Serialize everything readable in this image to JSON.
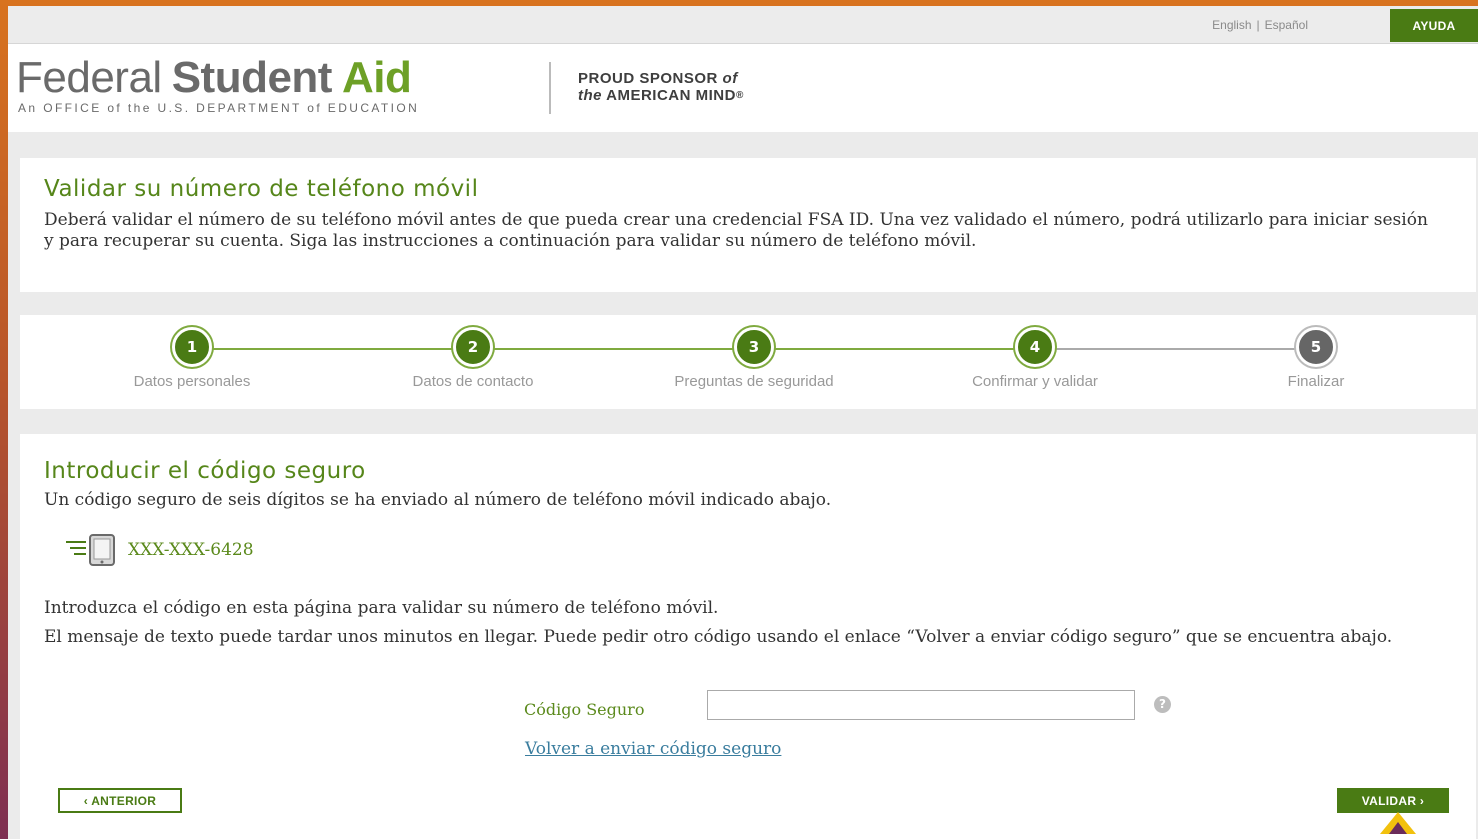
{
  "topbar": {
    "lang_english": "English",
    "lang_separator": "|",
    "lang_spanish": "Español",
    "help_label": "AYUDA"
  },
  "header": {
    "logo_word1": "Federal",
    "logo_word2": "Student",
    "logo_word3": "Aid",
    "logo_subtitle": "An OFFICE of the U.S. DEPARTMENT of EDUCATION",
    "sponsor_line1": "PROUD SPONSOR",
    "sponsor_of": "of",
    "sponsor_the": "the",
    "sponsor_line2": "AMERICAN MIND",
    "sponsor_mark": "®"
  },
  "intro": {
    "title": "Validar su número de teléfono móvil",
    "text": "Deberá validar el número de su teléfono móvil antes de que pueda crear una credencial FSA ID. Una vez validado el número, podrá utilizarlo para iniciar sesión y para recuperar su cuenta. Siga las instrucciones a continuación para validar su número de teléfono móvil."
  },
  "steps": [
    {
      "number": "1",
      "label": "Datos personales",
      "state": "complete"
    },
    {
      "number": "2",
      "label": "Datos de contacto",
      "state": "complete"
    },
    {
      "number": "3",
      "label": "Preguntas de seguridad",
      "state": "complete"
    },
    {
      "number": "4",
      "label": "Confirmar y validar",
      "state": "current"
    },
    {
      "number": "5",
      "label": "Finalizar",
      "state": "pending"
    }
  ],
  "form": {
    "title": "Introducir el código seguro",
    "description": "Un código seguro de seis dígitos se ha enviado al número de teléfono móvil indicado abajo.",
    "phone_icon": "mobile-phone-icon",
    "phone_number": "XXX-XXX-6428",
    "instruction1": "Introduzca el código en esta página para validar su número de teléfono móvil.",
    "instruction2": "El mensaje de texto puede tardar unos minutos en llegar. Puede pedir otro código usando el enlace “Volver a enviar código seguro” que se encuentra abajo.",
    "code_label": "Código Seguro",
    "code_value": "",
    "info_icon": "info-icon",
    "info_glyph": "?",
    "resend_link": "Volver a enviar código seguro",
    "prev_button": "‹ ANTERIOR",
    "next_button": "VALIDAR ›"
  },
  "colors": {
    "brand_green": "#4a7b14",
    "title_green": "#56861a",
    "link_blue": "#3a7d9e",
    "pointer_yellow": "#f2c10d"
  }
}
